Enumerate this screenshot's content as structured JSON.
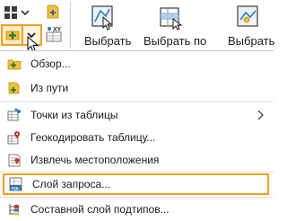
{
  "ribbon": {
    "buttons": [
      {
        "label": "Выбрать",
        "icon": "select-by-rectangle-icon"
      },
      {
        "label": "Выбрать по",
        "icon": "select-by-attributes-icon"
      },
      {
        "label": "Выбрать",
        "icon": "select-by-location-icon"
      }
    ],
    "small_icons": [
      "layers-icon",
      "add-layer-icon",
      "xy-data-icon",
      "add-data-icon",
      "dropdown-arrow-icon"
    ]
  },
  "menu": {
    "items": [
      {
        "label": "Обзор...",
        "icon": "browse-icon"
      },
      {
        "label": "Из пути",
        "icon": "from-path-icon"
      },
      {
        "label": "Точки из таблицы",
        "icon": "xy-table-icon",
        "has_submenu": true
      },
      {
        "label": "Геокодировать таблицу...",
        "icon": "geocode-table-icon"
      },
      {
        "label": "Извлечь местоположения",
        "icon": "extract-locations-icon"
      },
      {
        "label": "Слой запроса...",
        "icon": "query-layer-icon",
        "selected": true
      },
      {
        "label": "Составной слой подтипов...",
        "icon": "subtype-group-layer-icon"
      }
    ]
  },
  "colors": {
    "accent": "#f0a020",
    "highlight_fill": "#fde9c4",
    "icon_blue": "#2f6fb5",
    "icon_yellow": "#f2c037",
    "icon_red": "#c8382e"
  }
}
